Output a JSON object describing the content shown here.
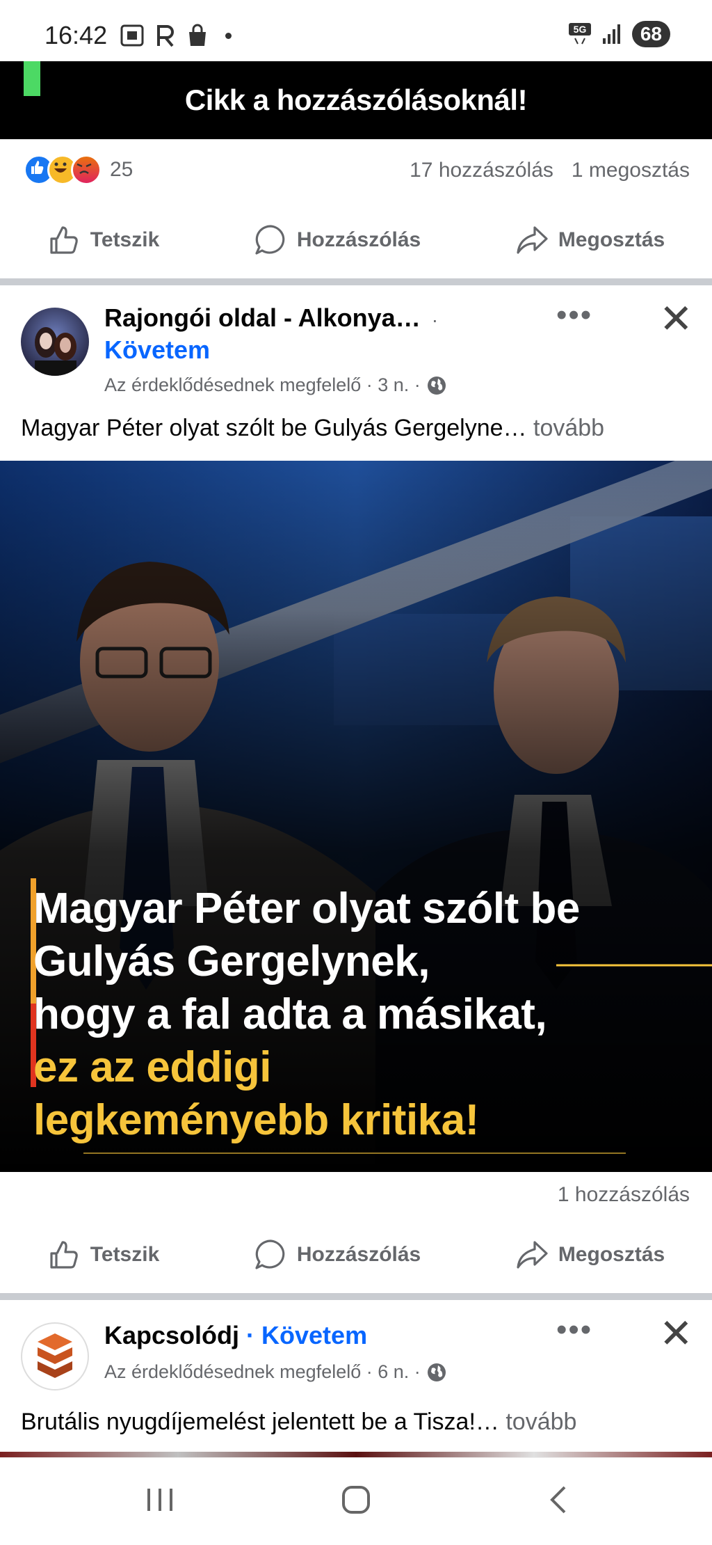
{
  "status_bar": {
    "time": "16:42",
    "network": "5G",
    "battery": "68"
  },
  "banner": {
    "text": "Cikk a hozzászólásoknál!"
  },
  "post1": {
    "reaction_count": "25",
    "comments": "17 hozzászólás",
    "shares": "1 megosztás"
  },
  "actions": {
    "like": "Tetszik",
    "comment": "Hozzászólás",
    "share": "Megosztás"
  },
  "post2": {
    "page_name": "Rajongói oldal - Alkonya…",
    "separator": "·",
    "follow": "Követem",
    "meta": "Az érdeklődésednek megfelelő · 3 n. ·",
    "text": "Magyar Péter olyat szólt be Gulyás Gergelyne…",
    "more": "tovább",
    "image_caption": {
      "line1": "Magyar Péter olyat szólt be",
      "line2": "Gulyás Gergelynek,",
      "line3": "hogy a fal adta a másikat,",
      "line4": "ez az eddigi",
      "line5": "legkeményebb kritika!"
    },
    "comments": "1 hozzászólás"
  },
  "post3": {
    "page_name": "Kapcsolódj",
    "follow": "· Követem",
    "meta": "Az érdeklődésednek megfelelő · 6 n. ·",
    "text": "Brutális nyugdíjemelést jelentett be a Tisza!…",
    "more": "tovább"
  },
  "colors": {
    "accent": "#0866ff",
    "muted": "#65676b",
    "divider": "#c9ccd1",
    "caption_yellow": "#f6c43b"
  }
}
